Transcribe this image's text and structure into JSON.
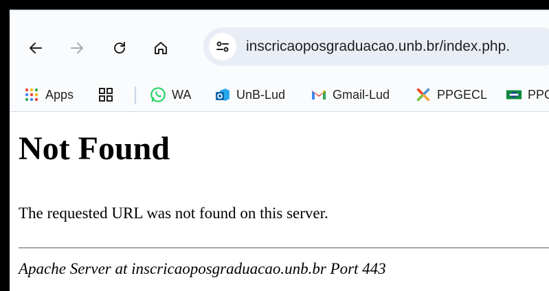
{
  "browser": {
    "address_bar": {
      "url": "inscricaoposgraduacao.unb.br/index.php."
    },
    "nav": {
      "back_icon": "arrow-left-icon",
      "forward_icon": "arrow-right-icon",
      "reload_icon": "reload-icon",
      "home_icon": "home-icon",
      "site_info_icon": "tune-icon"
    },
    "bookmarks": [
      {
        "label": "Apps",
        "icon": "apps-grid-icon"
      },
      {
        "label": "",
        "icon": "tab-groups-icon"
      },
      {
        "label": "WA",
        "icon": "whatsapp-icon"
      },
      {
        "label": "UnB-Lud",
        "icon": "outlook-icon"
      },
      {
        "label": "Gmail-Lud",
        "icon": "gmail-icon"
      },
      {
        "label": "PPGECL",
        "icon": "joomla-icon"
      },
      {
        "label": "PPG",
        "icon": "flag-icon"
      }
    ]
  },
  "page": {
    "title": "Not Found",
    "message": "The requested URL was not found on this server.",
    "server_signature": "Apache Server at inscricaoposgraduacao.unb.br Port 443"
  },
  "colors": {
    "toolbar_bg": "#f9fbfd",
    "omnibox_bg": "#e9eef6",
    "text": "#1f1f1f",
    "divider": "#a6a6a6"
  }
}
